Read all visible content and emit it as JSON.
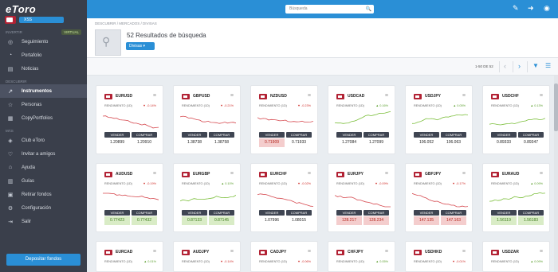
{
  "brand": {
    "logo": "eToro",
    "badge": "XSS"
  },
  "sidebar": {
    "invest_label": "INVERTIR",
    "virtual_badge": "VIRTUAL",
    "items1": [
      {
        "label": "Seguimiento",
        "icon": "watchlist-icon"
      },
      {
        "label": "Portafolio",
        "icon": "portfolio-icon"
      },
      {
        "label": "Noticias",
        "icon": "news-icon"
      }
    ],
    "discover_label": "DESCUBRIR",
    "items2": [
      {
        "label": "Instrumentos",
        "icon": "chart-icon",
        "active": true
      },
      {
        "label": "Personas",
        "icon": "star-icon"
      },
      {
        "label": "CopyPortfolios",
        "icon": "copyportfolio-icon"
      }
    ],
    "more_label": "MÁS",
    "items3": [
      {
        "label": "Club eToro",
        "icon": "club-icon"
      },
      {
        "label": "Invitar a amigos",
        "icon": "invite-icon"
      },
      {
        "label": "Ayuda",
        "icon": "help-icon"
      },
      {
        "label": "Guías",
        "icon": "guides-icon"
      },
      {
        "label": "Retirar fondos",
        "icon": "withdraw-icon"
      },
      {
        "label": "Configuración",
        "icon": "settings-icon"
      },
      {
        "label": "Salir",
        "icon": "logout-icon"
      }
    ],
    "deposit": "Depositar fondos"
  },
  "topbar": {
    "search_placeholder": "Búsqueda"
  },
  "header": {
    "breadcrumb": "DESCUBRIR / MERCADOS / DIVISAS",
    "results": "52 Resultados de búsqueda",
    "filter": "Divisas"
  },
  "pager": {
    "range": "1-50 DE 52"
  },
  "labels": {
    "rendimiento": "RENDIMIENTO (1D)",
    "sell": "VENDER",
    "buy": "COMPRAR"
  },
  "cards": [
    {
      "name": "EURUSD",
      "chg": "-0.14%",
      "dir": "red",
      "sell": "1.20899",
      "buy": "1.20910",
      "sc": "",
      "bc": ""
    },
    {
      "name": "GBPUSD",
      "chg": "-0.21%",
      "dir": "red",
      "sell": "1.38738",
      "buy": "1.38758",
      "sc": "",
      "bc": ""
    },
    {
      "name": "NZDUSD",
      "chg": "-0.23%",
      "dir": "red",
      "sell": "0.71909",
      "buy": "0.71933",
      "sc": "red",
      "bc": ""
    },
    {
      "name": "USDCAD",
      "chg": "0.16%",
      "dir": "green",
      "sell": "1.27084",
      "buy": "1.27099",
      "sc": "",
      "bc": ""
    },
    {
      "name": "USDJPY",
      "chg": "0.05%",
      "dir": "green",
      "sell": "106.052",
      "buy": "106.063",
      "sc": "",
      "bc": ""
    },
    {
      "name": "USDCHF",
      "chg": "0.13%",
      "dir": "green",
      "sell": "0.89333",
      "buy": "0.89347",
      "sc": "",
      "bc": ""
    },
    {
      "name": "AUDUSD",
      "chg": "-0.19%",
      "dir": "red",
      "sell": "0.77423",
      "buy": "0.77432",
      "sc": "green",
      "bc": "green"
    },
    {
      "name": "EURGBP",
      "chg": "0.10%",
      "dir": "green",
      "sell": "0.87133",
      "buy": "0.87145",
      "sc": "green",
      "bc": "green"
    },
    {
      "name": "EURCHF",
      "chg": "-0.02%",
      "dir": "red",
      "sell": "1.07996",
      "buy": "1.08015",
      "sc": "",
      "bc": ""
    },
    {
      "name": "EURJPY",
      "chg": "-0.09%",
      "dir": "red",
      "sell": "128.217",
      "buy": "128.234",
      "sc": "red",
      "bc": "red"
    },
    {
      "name": "GBPJPY",
      "chg": "-0.17%",
      "dir": "red",
      "sell": "147.135",
      "buy": "147.163",
      "sc": "red",
      "bc": "red"
    },
    {
      "name": "EURAUD",
      "chg": "0.09%",
      "dir": "green",
      "sell": "1.56119",
      "buy": "1.56183",
      "sc": "green",
      "bc": "green"
    },
    {
      "name": "EURCAD",
      "chg": "0.01%",
      "dir": "green",
      "sell": "",
      "buy": "",
      "sc": "",
      "bc": ""
    },
    {
      "name": "AUDJPY",
      "chg": "-0.14%",
      "dir": "red",
      "sell": "",
      "buy": "",
      "sc": "",
      "bc": ""
    },
    {
      "name": "CADJPY",
      "chg": "-0.06%",
      "dir": "red",
      "sell": "",
      "buy": "",
      "sc": "",
      "bc": ""
    },
    {
      "name": "CHFJPY",
      "chg": "0.05%",
      "dir": "green",
      "sell": "",
      "buy": "",
      "sc": "",
      "bc": ""
    },
    {
      "name": "USDHKD",
      "chg": "-0.01%",
      "dir": "red",
      "sell": "",
      "buy": "",
      "sc": "",
      "bc": ""
    },
    {
      "name": "USDZAR",
      "chg": "0.09%",
      "dir": "green",
      "sell": "",
      "buy": "",
      "sc": "",
      "bc": ""
    }
  ]
}
